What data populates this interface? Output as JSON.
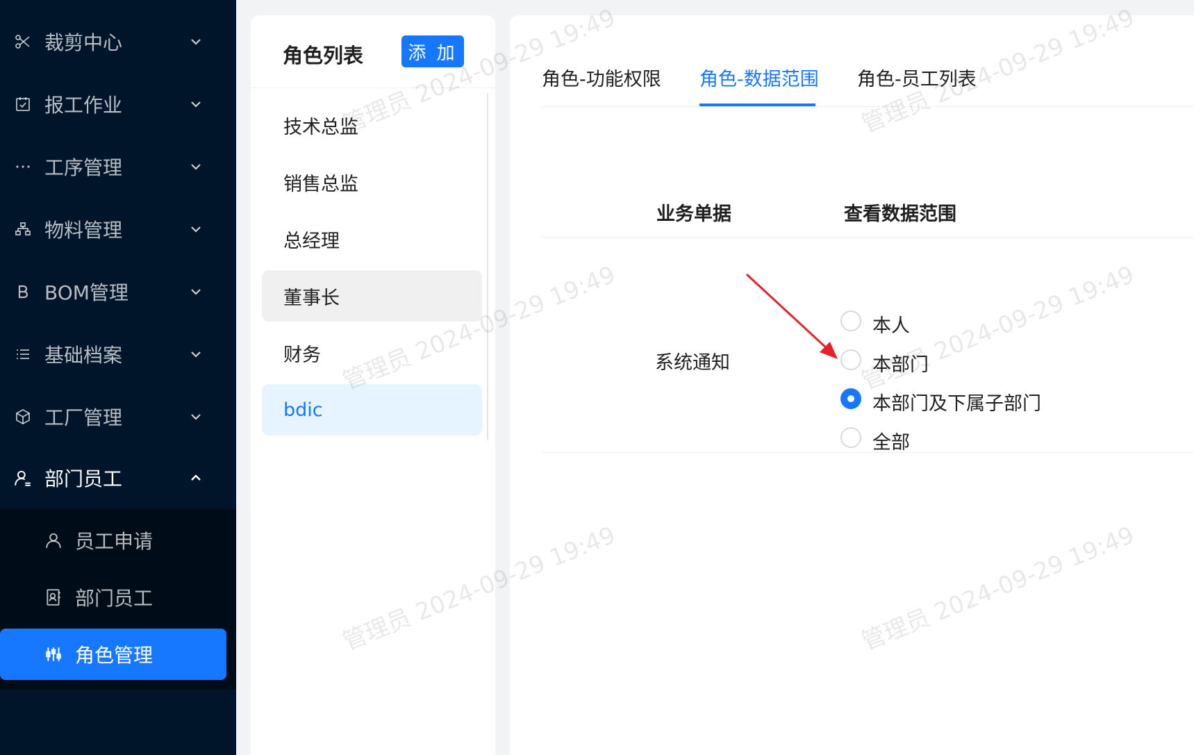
{
  "sidebar": {
    "menu": [
      {
        "label": "裁剪中心",
        "icon": "scissors-icon"
      },
      {
        "label": "报工作业",
        "icon": "calendar-check-icon"
      },
      {
        "label": "工序管理",
        "icon": "ellipsis-icon"
      },
      {
        "label": "物料管理",
        "icon": "cluster-icon"
      },
      {
        "label": "BOM管理",
        "icon": "bold-b-icon"
      },
      {
        "label": "基础档案",
        "icon": "list-icon"
      },
      {
        "label": "工厂管理",
        "icon": "cube-icon"
      },
      {
        "label": "部门员工",
        "icon": "user-add-icon"
      }
    ],
    "submenu": [
      {
        "label": "员工申请",
        "icon": "user-icon"
      },
      {
        "label": "部门员工",
        "icon": "contacts-icon"
      },
      {
        "label": "角色管理",
        "icon": "sliders-icon"
      }
    ]
  },
  "role_panel": {
    "title": "角色列表",
    "add_label": "添 加",
    "roles": [
      "技术总监",
      "销售总监",
      "总经理",
      "董事长",
      "财务",
      "bdic"
    ]
  },
  "main": {
    "tabs": [
      "角色-功能权限",
      "角色-数据范围",
      "角色-员工列表"
    ],
    "active_tab": "角色-数据范围",
    "table": {
      "headers": [
        "业务单据",
        "查看数据范围"
      ],
      "row": {
        "doc": "系统通知",
        "options": [
          "本人",
          "本部门",
          "本部门及下属子部门",
          "全部"
        ],
        "selected": "本部门及下属子部门"
      }
    }
  },
  "watermark": "管理员 2024-09-29 19:49",
  "colors": {
    "accent": "#1677ff",
    "sidebar_bg": "#001529",
    "annotation_arrow": "#e8202a"
  }
}
